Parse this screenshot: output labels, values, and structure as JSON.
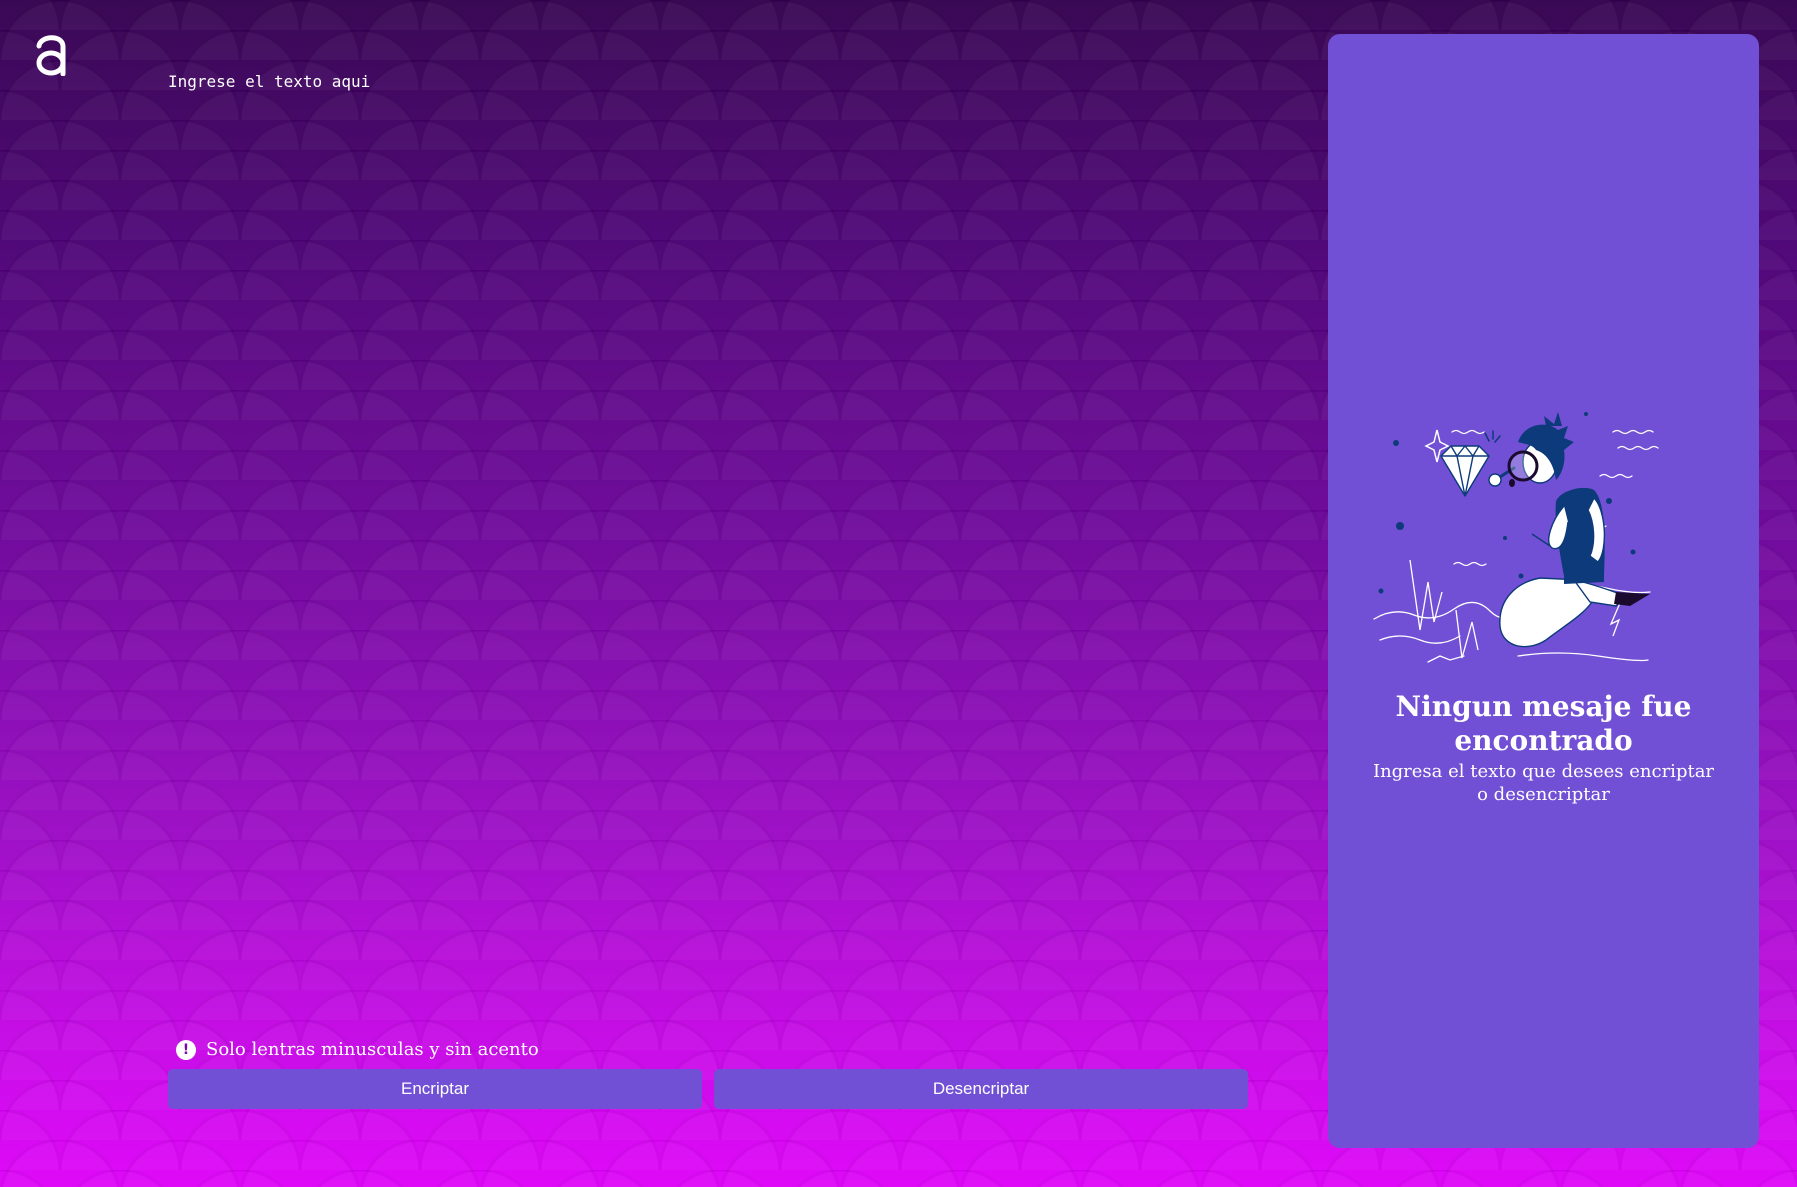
{
  "brand": {
    "logo_glyph": "a",
    "logo_icon": "alura-logo-icon"
  },
  "input": {
    "placeholder": "Ingrese el texto aqui",
    "value": ""
  },
  "hint": {
    "icon": "exclamation-circle-icon",
    "text": "Solo lentras minusculas y sin acento"
  },
  "actions": {
    "encrypt_label": "Encriptar",
    "decrypt_label": "Desencriptar"
  },
  "output_panel": {
    "illustration": "person-with-magnifier-and-diamond-illustration",
    "title": "Ningun mesaje fue encontrado",
    "subtitle": "Ingresa el texto que desees encriptar o desencriptar"
  },
  "colors": {
    "background_top": "#33004f",
    "background_bottom": "#de00f8",
    "accent": "#7150d5",
    "text": "#ffffff",
    "illustration_navy": "#0c3a7a"
  }
}
